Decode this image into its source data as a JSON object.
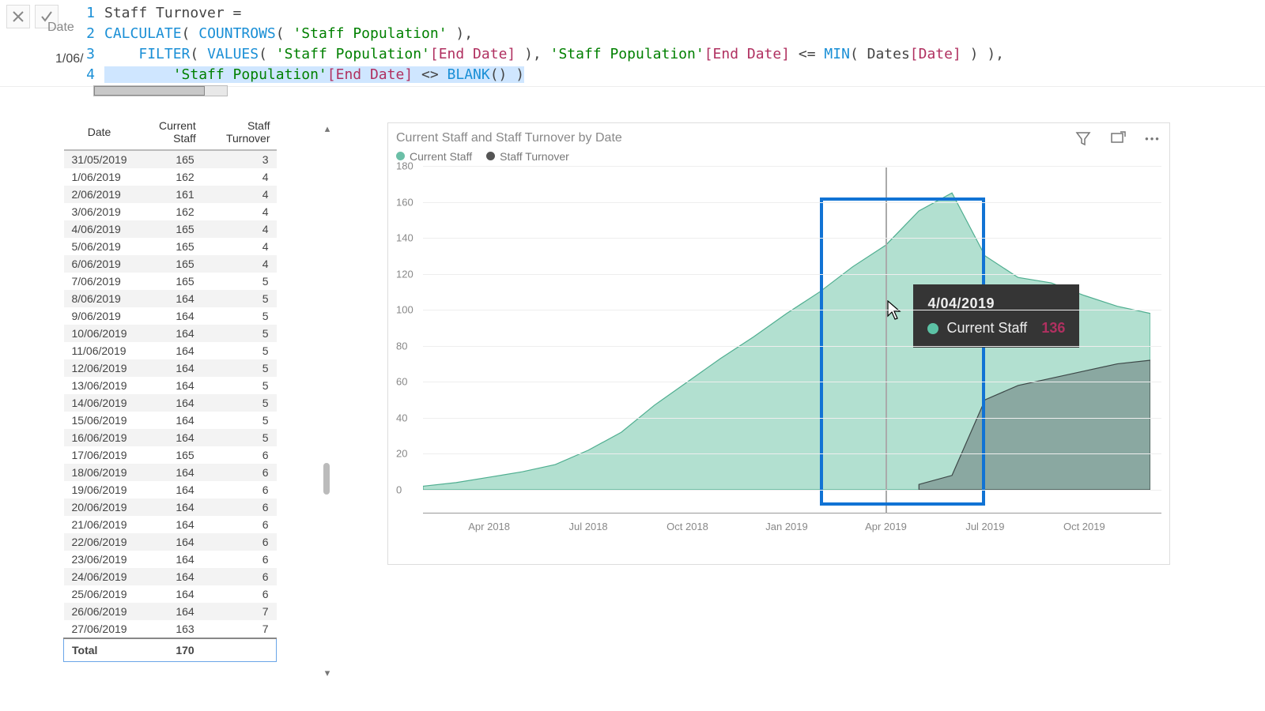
{
  "formula_bar": {
    "bg_header": "Date",
    "bg_value": "1/06/",
    "lines": [
      {
        "n": "1",
        "plain": "Staff Turnover ="
      },
      {
        "n": "2",
        "tokens": [
          [
            "kw",
            "CALCULATE"
          ],
          [
            "idn",
            "( "
          ],
          [
            "kw",
            "COUNTROWS"
          ],
          [
            "idn",
            "( "
          ],
          [
            "txt",
            "'Staff Population'"
          ],
          [
            "idn",
            " ),"
          ]
        ]
      },
      {
        "n": "3",
        "tokens": [
          [
            "idn",
            "    "
          ],
          [
            "kw",
            "FILTER"
          ],
          [
            "idn",
            "( "
          ],
          [
            "kw",
            "VALUES"
          ],
          [
            "idn",
            "( "
          ],
          [
            "txt",
            "'Staff Population'"
          ],
          [
            "val",
            "[End Date]"
          ],
          [
            "idn",
            " ), "
          ],
          [
            "txt",
            "'Staff Population'"
          ],
          [
            "val",
            "[End Date]"
          ],
          [
            "idn",
            " <= "
          ],
          [
            "kw",
            "MIN"
          ],
          [
            "idn",
            "( Dates"
          ],
          [
            "val",
            "[Date]"
          ],
          [
            "idn",
            " ) ),"
          ]
        ]
      },
      {
        "n": "4",
        "hl": true,
        "tokens": [
          [
            "idn",
            "        "
          ],
          [
            "txt",
            "'Staff Population'"
          ],
          [
            "val",
            "[End Date]"
          ],
          [
            "idn",
            " <> "
          ],
          [
            "kw",
            "BLANK"
          ],
          [
            "idn",
            "() )"
          ]
        ]
      }
    ]
  },
  "table": {
    "headers": [
      "Date",
      "Current Staff",
      "Staff Turnover"
    ],
    "rows": [
      [
        "31/05/2019",
        "165",
        "3"
      ],
      [
        "1/06/2019",
        "162",
        "4"
      ],
      [
        "2/06/2019",
        "161",
        "4"
      ],
      [
        "3/06/2019",
        "162",
        "4"
      ],
      [
        "4/06/2019",
        "165",
        "4"
      ],
      [
        "5/06/2019",
        "165",
        "4"
      ],
      [
        "6/06/2019",
        "165",
        "4"
      ],
      [
        "7/06/2019",
        "165",
        "5"
      ],
      [
        "8/06/2019",
        "164",
        "5"
      ],
      [
        "9/06/2019",
        "164",
        "5"
      ],
      [
        "10/06/2019",
        "164",
        "5"
      ],
      [
        "11/06/2019",
        "164",
        "5"
      ],
      [
        "12/06/2019",
        "164",
        "5"
      ],
      [
        "13/06/2019",
        "164",
        "5"
      ],
      [
        "14/06/2019",
        "164",
        "5"
      ],
      [
        "15/06/2019",
        "164",
        "5"
      ],
      [
        "16/06/2019",
        "164",
        "5"
      ],
      [
        "17/06/2019",
        "165",
        "6"
      ],
      [
        "18/06/2019",
        "164",
        "6"
      ],
      [
        "19/06/2019",
        "164",
        "6"
      ],
      [
        "20/06/2019",
        "164",
        "6"
      ],
      [
        "21/06/2019",
        "164",
        "6"
      ],
      [
        "22/06/2019",
        "164",
        "6"
      ],
      [
        "23/06/2019",
        "164",
        "6"
      ],
      [
        "24/06/2019",
        "164",
        "6"
      ],
      [
        "25/06/2019",
        "164",
        "6"
      ],
      [
        "26/06/2019",
        "164",
        "7"
      ],
      [
        "27/06/2019",
        "163",
        "7"
      ]
    ],
    "total_label": "Total",
    "total_value": "170"
  },
  "chart_ui": {
    "title": "Current Staff and Staff Turnover by Date",
    "legend": [
      "Current Staff",
      "Staff Turnover"
    ],
    "tooltip": {
      "date": "4/04/2019",
      "series": "Current Staff",
      "value": "136"
    }
  },
  "chart_data": {
    "type": "area",
    "title": "Current Staff and Staff Turnover by Date",
    "ylabel": "",
    "xlabel": "",
    "ylim": [
      0,
      180
    ],
    "x_ticks": [
      "Apr 2018",
      "Jul 2018",
      "Oct 2018",
      "Jan 2019",
      "Apr 2019",
      "Jul 2019",
      "Oct 2019"
    ],
    "y_ticks": [
      0,
      20,
      40,
      60,
      80,
      100,
      120,
      140,
      160,
      180
    ],
    "series": [
      {
        "name": "Current Staff",
        "color": "#94d3c0",
        "values": [
          [
            "2018-02",
            2
          ],
          [
            "2018-03",
            4
          ],
          [
            "2018-04",
            7
          ],
          [
            "2018-05",
            10
          ],
          [
            "2018-06",
            14
          ],
          [
            "2018-07",
            22
          ],
          [
            "2018-08",
            32
          ],
          [
            "2018-09",
            47
          ],
          [
            "2018-10",
            60
          ],
          [
            "2018-11",
            73
          ],
          [
            "2018-12",
            85
          ],
          [
            "2019-01",
            98
          ],
          [
            "2019-02",
            110
          ],
          [
            "2019-03",
            124
          ],
          [
            "2019-04",
            136
          ],
          [
            "2019-05",
            155
          ],
          [
            "2019-06",
            165
          ],
          [
            "2019-07",
            130
          ],
          [
            "2019-08",
            118
          ],
          [
            "2019-09",
            115
          ],
          [
            "2019-10",
            108
          ],
          [
            "2019-11",
            102
          ],
          [
            "2019-12",
            98
          ]
        ]
      },
      {
        "name": "Staff Turnover",
        "color": "#5a6b6b",
        "values": [
          [
            "2019-05",
            3
          ],
          [
            "2019-06",
            8
          ],
          [
            "2019-07",
            50
          ],
          [
            "2019-08",
            58
          ],
          [
            "2019-09",
            62
          ],
          [
            "2019-10",
            66
          ],
          [
            "2019-11",
            70
          ],
          [
            "2019-12",
            72
          ]
        ]
      }
    ],
    "selection": {
      "from": "2019-02",
      "to": "2019-07"
    },
    "hover": {
      "x": "2019-04",
      "series": "Current Staff",
      "value": 136
    }
  }
}
